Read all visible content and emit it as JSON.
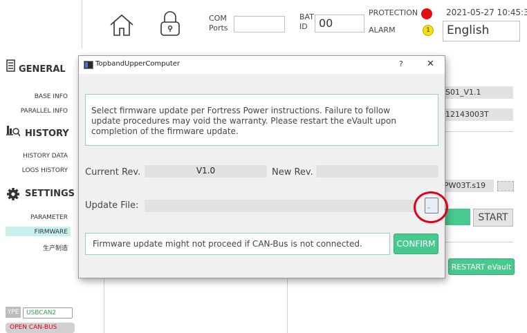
{
  "header": {
    "com_label": "COM\nPorts",
    "com_top": "COM",
    "com_bottom": "Ports",
    "com_value": "",
    "bat_top": "BAT",
    "bat_bottom": "ID",
    "bat_value": "00",
    "protection_label": "PROTECTION",
    "alarm_label": "ALARM",
    "alarm_badge": "1",
    "datetime": "2021-05-27 10:45:37",
    "language": "English"
  },
  "sidebar": {
    "general": "GENERAL",
    "base_info": "BASE INFO",
    "parallel_info": "PARALLEL INFO",
    "history": "HISTORY",
    "history_data": "HISTORY DATA",
    "logs_history": "LOGS HISTORY",
    "settings": "SETTINGS",
    "parameter": "PARAMETER",
    "firmware": "FIRMWARE",
    "manufacture": "生产制造",
    "type_label": "YPE",
    "type_value": "USBCAN2",
    "open_can_bus": "OPEN CAN-BUS"
  },
  "background_fields": {
    "field1": "S01_V1.1",
    "field2": "12143003T",
    "file_name": "PW03T.s19",
    "start": "START",
    "restart": "RESTART eVault"
  },
  "dialog": {
    "title": "TopbandUpperComputer",
    "help": "?",
    "close": "✕",
    "notice": "Select firmware update per Fortress Power instructions. Failure to follow update procedures may void the warranty. Please restart the eVault upon completion of the firmware update.",
    "current_rev_label": "Current Rev.",
    "current_rev_value": "V1.0",
    "new_rev_label": "New Rev.",
    "new_rev_value": "",
    "update_file_label": "Update File:",
    "update_file_value": "",
    "warning": "Firmware update might not proceed if CAN-Bus is not connected.",
    "confirm": "CONFIRM"
  },
  "colors": {
    "accent_green": "#48c98f",
    "protection_red": "#e01010",
    "alarm_yellow": "#f3e010",
    "highlight_circle": "#e0001b",
    "firmware_highlight": "#c8f1ee"
  }
}
